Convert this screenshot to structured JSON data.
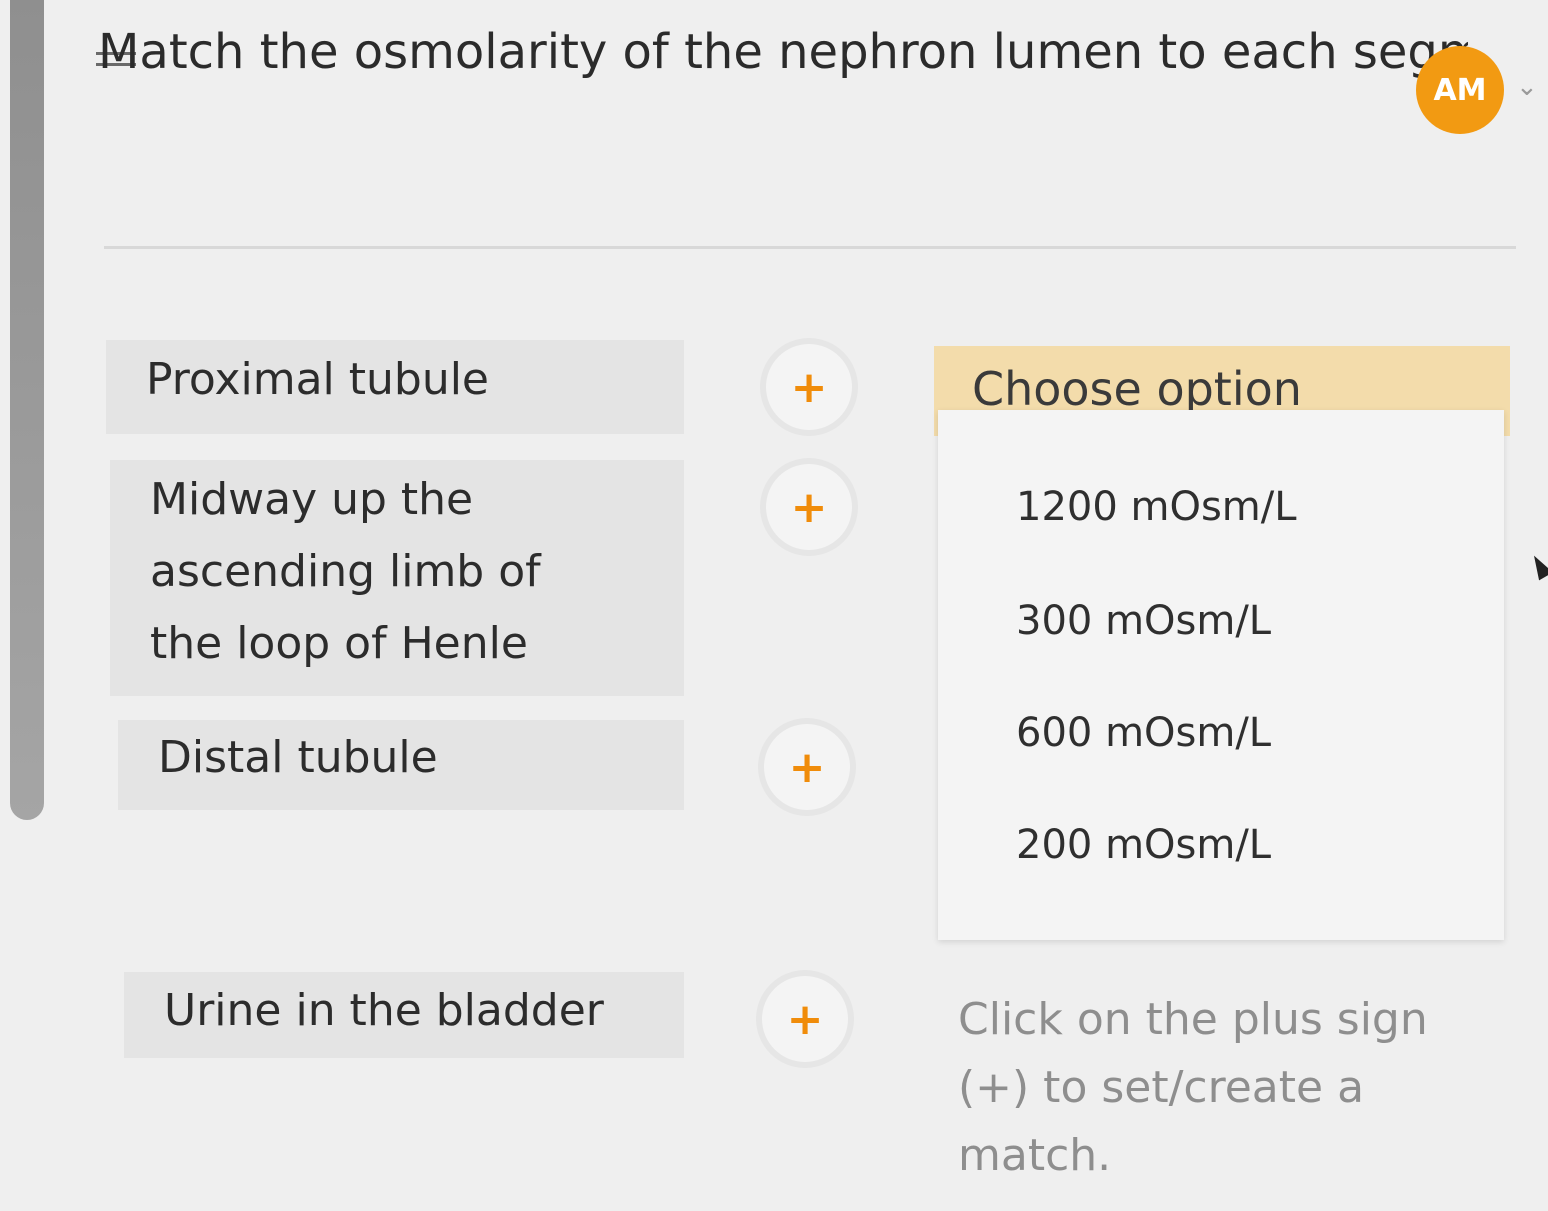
{
  "question": {
    "text": "Match the osmolarity of the nephron lumen to each segment of the tubular fluid in a healthy individual in normal water balance."
  },
  "user": {
    "initials": "AM"
  },
  "terms": [
    {
      "label": "Proximal tubule"
    },
    {
      "label": "Midway up the ascending limb of the loop of Henle"
    },
    {
      "label": "Distal tubule"
    },
    {
      "label": "Urine in the bladder"
    }
  ],
  "plus_symbol": "+",
  "dropdown": {
    "placeholder": "Choose option",
    "options": [
      "1200 mOsm/L",
      "300 mOsm/L",
      "600 mOsm/L",
      "200 mOsm/L"
    ]
  },
  "hint": "Click on the plus sign (+) to set/create a match.",
  "colors": {
    "accent": "#f08c0a",
    "avatar": "#f29a12",
    "dropdown_header": "#f3dcab"
  }
}
